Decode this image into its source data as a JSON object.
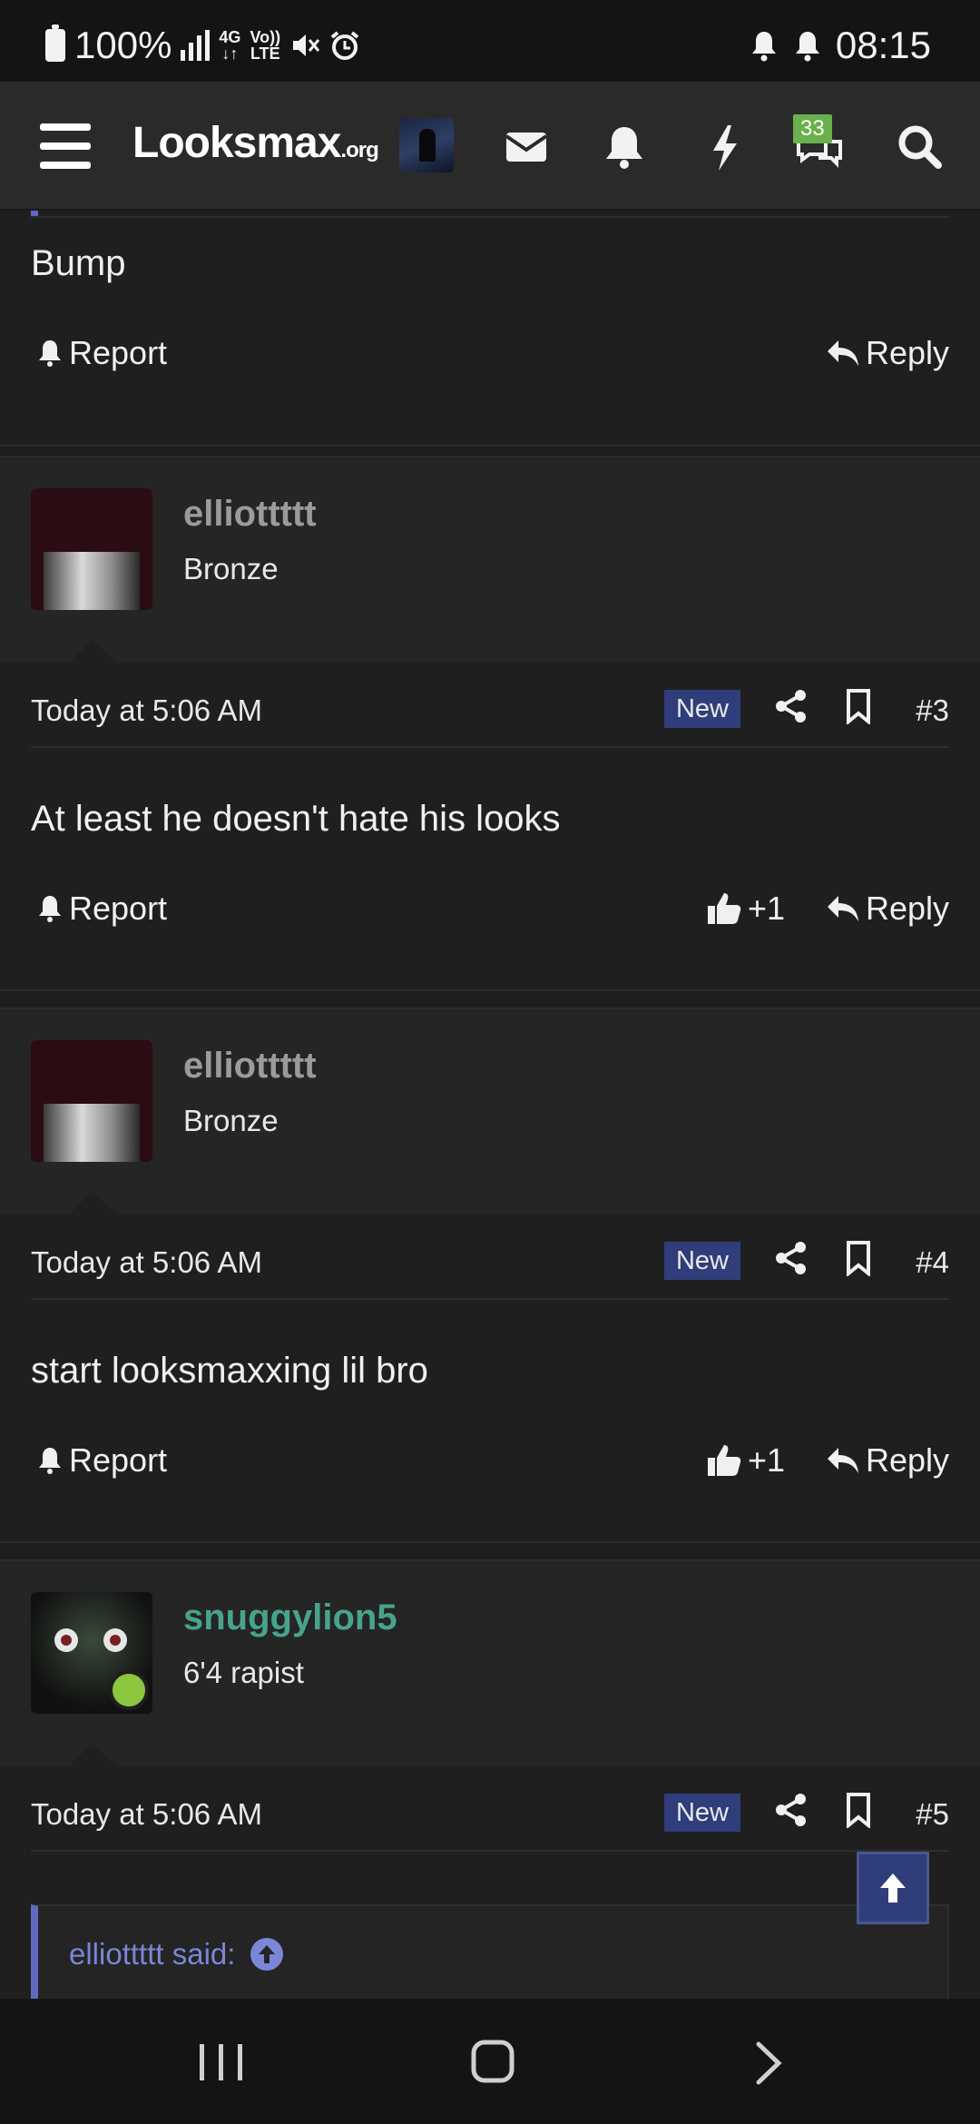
{
  "status_bar": {
    "battery": "100%",
    "network_top": "4G",
    "network_bottom": "",
    "volte_top": "Vo))",
    "volte_bottom": "LTE",
    "time": "08:15"
  },
  "header": {
    "logo_main": "Looksmax",
    "logo_suffix": ".org",
    "conversations_badge": "33",
    "icons": [
      "menu-icon",
      "avatar",
      "envelope-icon",
      "bell-icon",
      "lightning-icon",
      "chat-icon",
      "search-icon"
    ]
  },
  "top_post": {
    "message": "Bump",
    "report_label": "Report",
    "reply_label": "Reply"
  },
  "posts": [
    {
      "username": "elliottttt",
      "user_title": "Bronze",
      "date": "Today at 5:06 AM",
      "new_label": "New",
      "number": "#3",
      "message": "At least he doesn't hate his looks",
      "report_label": "Report",
      "like_count": "+1",
      "reply_label": "Reply"
    },
    {
      "username": "elliottttt",
      "user_title": "Bronze",
      "date": "Today at 5:06 AM",
      "new_label": "New",
      "number": "#4",
      "message": "start looksmaxxing lil bro",
      "report_label": "Report",
      "like_count": "+1",
      "reply_label": "Reply"
    },
    {
      "username": "snuggylion5",
      "user_title": "6'4 rapist",
      "date": "Today at 5:06 AM",
      "new_label": "New",
      "number": "#5",
      "quote_author": "elliottttt said:"
    }
  ],
  "colors": {
    "accent_blue": "#2f3e7a",
    "quote_link": "#7a86d6",
    "green_user": "#47a38c",
    "online": "#8dc63f"
  }
}
